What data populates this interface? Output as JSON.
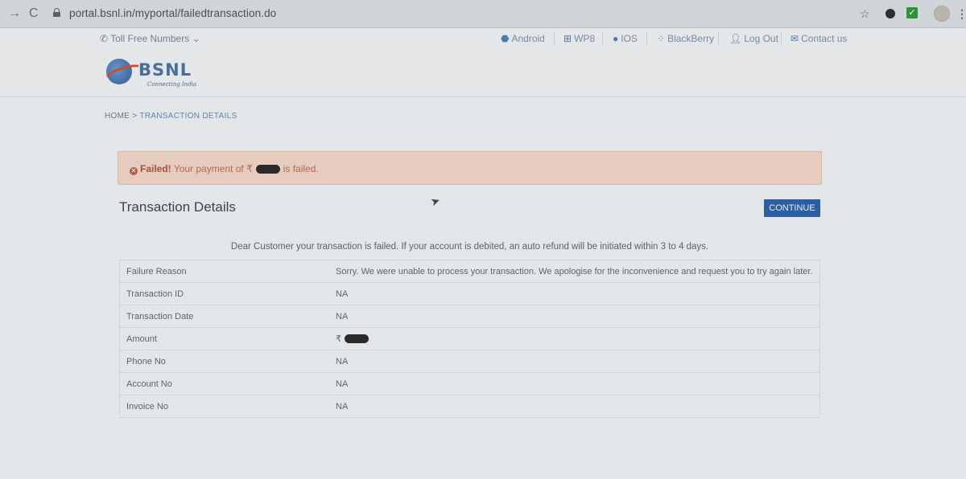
{
  "browser": {
    "url": "portal.bsnl.in/myportal/failedtransaction.do",
    "back_glyph": "→",
    "reload_glyph": "C",
    "star_glyph": "☆",
    "menu_glyph": "⋮",
    "ext_check_glyph": "✓"
  },
  "header": {
    "toll_free": "Toll Free Numbers",
    "nav": [
      {
        "label": "Android",
        "icon": "android-icon"
      },
      {
        "label": "WP8",
        "icon": "windows-icon"
      },
      {
        "label": "IOS",
        "icon": "apple-icon"
      },
      {
        "label": "BlackBerry",
        "icon": "blackberry-icon"
      },
      {
        "label": "Log Out",
        "icon": "user-icon"
      },
      {
        "label": "Contact us",
        "icon": "mail-icon"
      }
    ],
    "logo_text": "BSNL",
    "logo_tagline": "Connecting India"
  },
  "breadcrumb": {
    "home": "HOME",
    "separator": ">",
    "current": "TRANSACTION DETAILS"
  },
  "alert": {
    "strong": "Failed!",
    "text_before": "Your payment of ₹",
    "text_after": "is failed."
  },
  "main": {
    "title": "Transaction Details",
    "continue_label": "CONTINUE",
    "notice": "Dear Customer your transaction is failed. If your account is debited, an auto refund will be initiated within 3 to 4 days."
  },
  "details": [
    {
      "label": "Failure Reason",
      "value": "Sorry. We were unable to process your transaction. We apologise for the inconvenience and request you to try again later."
    },
    {
      "label": "Transaction ID",
      "value": "NA"
    },
    {
      "label": "Transaction Date",
      "value": "NA"
    },
    {
      "label": "Amount",
      "value": "₹"
    },
    {
      "label": "Phone No",
      "value": "NA"
    },
    {
      "label": "Account No",
      "value": "NA"
    },
    {
      "label": "Invoice No",
      "value": "NA"
    }
  ],
  "colors": {
    "continue_button": "#2c5ea3",
    "alert_background": "#e6cbbf",
    "alert_text": "#b4664f",
    "link": "#5f83b0"
  }
}
